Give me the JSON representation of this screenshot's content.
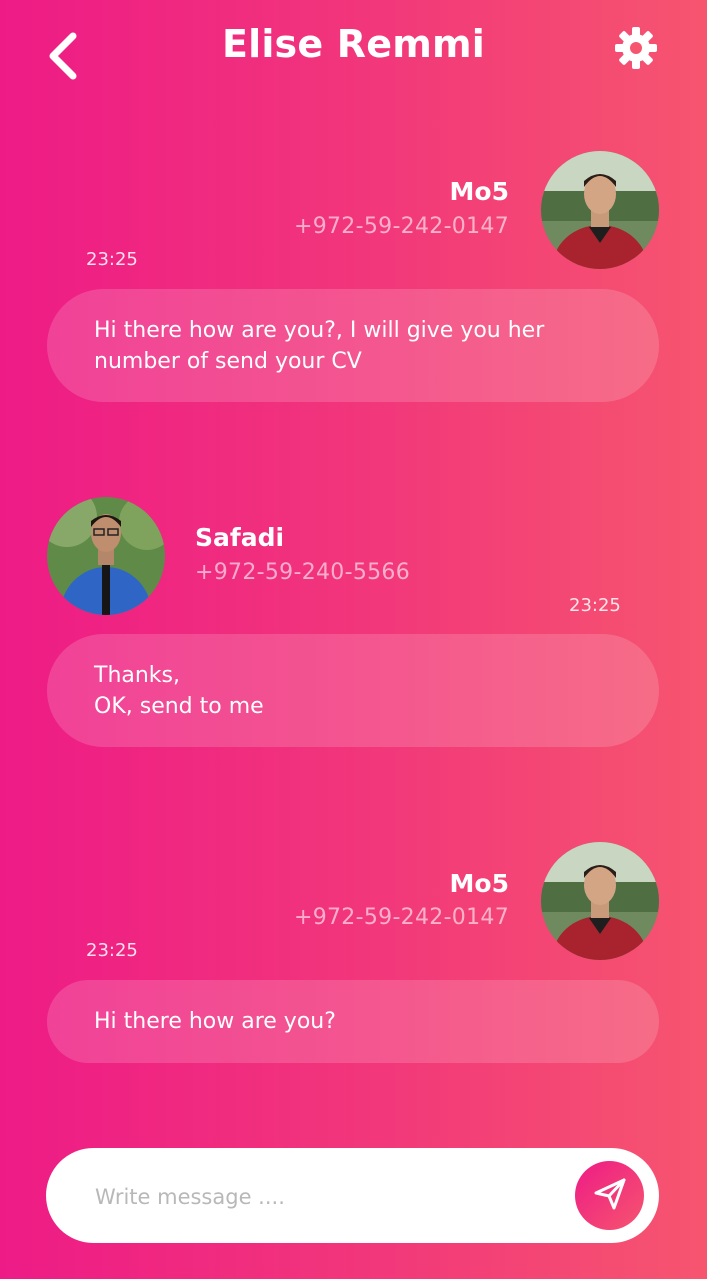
{
  "header": {
    "title": "Elise Remmi",
    "back_icon": "chevron-left-icon",
    "settings_icon": "gear-icon"
  },
  "messages": [
    {
      "sender": "Mo5",
      "phone": "+972-59-242-0147",
      "time": "23:25",
      "text": "Hi there how are you?, I will give you her\nnumber of send your CV"
    },
    {
      "sender": "Safadi",
      "phone": "+972-59-240-5566",
      "time": "23:25",
      "text": "Thanks,\nOK, send to me"
    },
    {
      "sender": "Mo5",
      "phone": "+972-59-242-0147",
      "time": "23:25",
      "text": "Hi there how are you?"
    }
  ],
  "composer": {
    "placeholder": "Write message ....",
    "value": "",
    "send_icon": "paper-plane-icon"
  },
  "colors": {
    "gradient_start": "#EE1B86",
    "gradient_end": "#F6556F",
    "bubble": "rgba(255,255,255,0.16)"
  }
}
